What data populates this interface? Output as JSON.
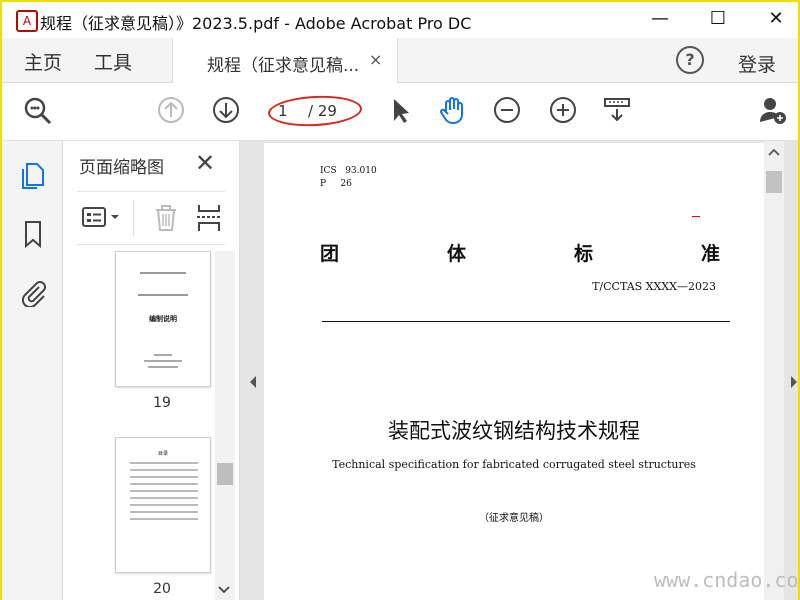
{
  "window": {
    "title": "规程（征求意见稿）》2023.5.pdf - Adobe Acrobat Pro DC",
    "minimize": "—",
    "maximize": "☐",
    "close": "✕"
  },
  "menu": {
    "home": "主页",
    "tools": "工具",
    "doc_tab": "规程（征求意见稿...",
    "doc_tab_close": "×",
    "help": "?",
    "login": "登录"
  },
  "toolbar": {
    "current_page": "1",
    "total_pages": "/ 29"
  },
  "thumbnails": {
    "title": "页面缩略图",
    "close": "✕",
    "pages": [
      {
        "number": "19",
        "heading": "编制说明"
      },
      {
        "number": "20",
        "heading": "目录"
      }
    ]
  },
  "document": {
    "ics": "ICS   93.010\nP     26",
    "standard_chars": [
      "团",
      "体",
      "标",
      "准"
    ],
    "standard_number": "T/CCTAS  XXXX—2023",
    "title": "装配式波纹钢结构技术规程",
    "subtitle": "Technical specification for fabricated corrugated steel structures",
    "draft_note": "（征求意见稿）"
  },
  "watermark": "www.cndao.com",
  "colors": {
    "accent_blue": "#1473e6",
    "annotation_red": "#d8261c",
    "frame_yellow": "#f0e000"
  }
}
